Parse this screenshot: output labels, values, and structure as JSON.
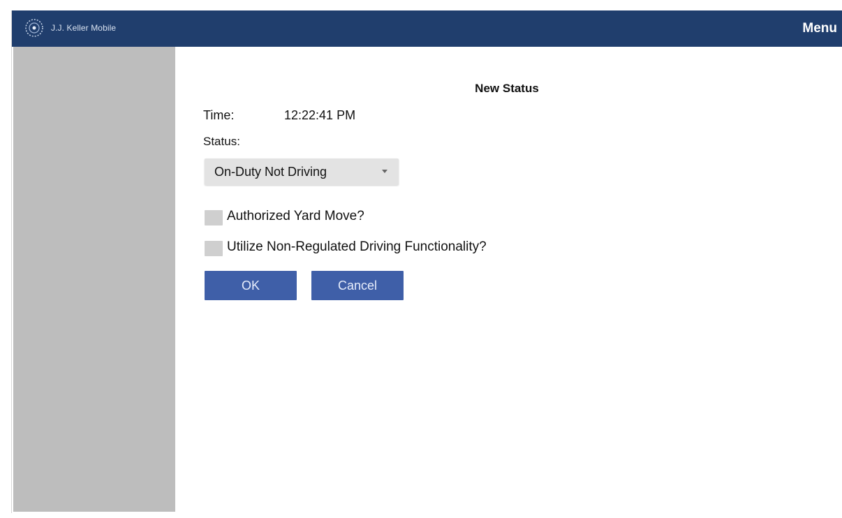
{
  "header": {
    "brand": "J.J. Keller Mobile",
    "logo_icon": "globe-logo-icon",
    "menu_label": "Menu",
    "background_color": "#203e6d"
  },
  "dialog": {
    "title": "New Status",
    "time_label": "Time:",
    "time_value": "12:22:41 PM",
    "status_label": "Status:",
    "status_selected": "On-Duty Not Driving",
    "checkboxes": [
      {
        "label": "Authorized Yard Move?",
        "checked": false
      },
      {
        "label": "Utilize Non-Regulated Driving Functionality?",
        "checked": false
      }
    ],
    "ok_label": "OK",
    "cancel_label": "Cancel",
    "button_color": "#3f5fa8"
  },
  "sidebar": {
    "background_color": "#bdbdbd"
  }
}
